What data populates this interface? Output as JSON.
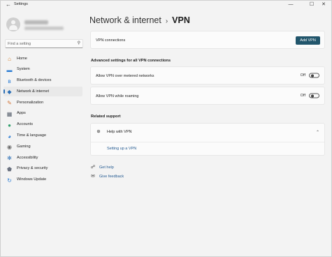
{
  "window": {
    "title": "Settings",
    "back_glyph": "←",
    "controls": {
      "minimize": "—",
      "maximize": "☐",
      "close": "✕"
    }
  },
  "search": {
    "placeholder": "Find a setting",
    "icon": "search-icon"
  },
  "sidebar": {
    "items": [
      {
        "label": "Home",
        "icon": "home-icon",
        "glyph": "⌂",
        "color": "#d9822b"
      },
      {
        "label": "System",
        "icon": "monitor-icon",
        "glyph": "▬",
        "color": "#2b7cd3"
      },
      {
        "label": "Bluetooth & devices",
        "icon": "bluetooth-icon",
        "glyph": "ʙ",
        "color": "#2b7cd3"
      },
      {
        "label": "Network & internet",
        "icon": "wifi-icon",
        "glyph": "◆",
        "color": "#2b6fb6",
        "selected": true
      },
      {
        "label": "Personalization",
        "icon": "brush-icon",
        "glyph": "✎",
        "color": "#d27537"
      },
      {
        "label": "Apps",
        "icon": "apps-icon",
        "glyph": "▦",
        "color": "#555e6b"
      },
      {
        "label": "Accounts",
        "icon": "person-icon",
        "glyph": "●",
        "color": "#2f9e6b"
      },
      {
        "label": "Time & language",
        "icon": "globe-clock-icon",
        "glyph": "◕",
        "color": "#2b7cd3"
      },
      {
        "label": "Gaming",
        "icon": "gamepad-icon",
        "glyph": "◉",
        "color": "#6b6b6b"
      },
      {
        "label": "Accessibility",
        "icon": "accessibility-icon",
        "glyph": "✻",
        "color": "#2b6fb6"
      },
      {
        "label": "Privacy & security",
        "icon": "shield-icon",
        "glyph": "⬟",
        "color": "#6b7280"
      },
      {
        "label": "Windows Update",
        "icon": "update-icon",
        "glyph": "↻",
        "color": "#2b7cd3"
      }
    ]
  },
  "header": {
    "breadcrumb": "Network & internet",
    "separator": "›",
    "current": "VPN"
  },
  "vpn_connections": {
    "label": "VPN connections",
    "button": "Add VPN"
  },
  "advanced": {
    "heading": "Advanced settings for all VPN connections",
    "metered": {
      "label": "Allow VPN over metered networks",
      "state": "Off"
    },
    "roaming": {
      "label": "Allow VPN while roaming",
      "state": "Off"
    }
  },
  "related": {
    "heading": "Related support",
    "help": {
      "label": "Help with VPN",
      "icon": "globe-icon",
      "chevron": "⌃"
    },
    "link": "Setting up a VPN"
  },
  "footer": {
    "get_help": "Get help",
    "feedback": "Give feedback"
  },
  "colors": {
    "accent": "#22566c",
    "link": "#245a91",
    "background": "#f3f3f3",
    "card": "#fbfbfb"
  }
}
